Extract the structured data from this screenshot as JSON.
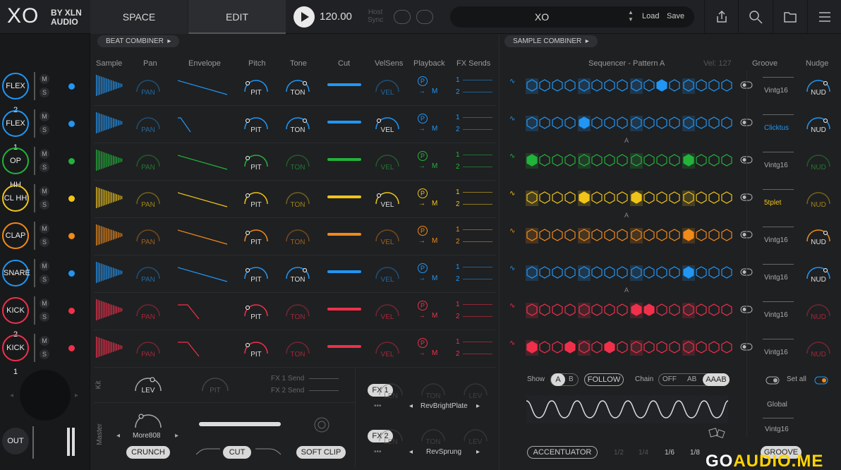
{
  "topbar": {
    "logo_xo": "XO",
    "logo_by": "BY XLN",
    "logo_audio": "AUDIO",
    "tab_space": "SPACE",
    "tab_edit": "EDIT",
    "bpm": "120.00",
    "host_sync": "Host\nSync",
    "kit_name": "XO",
    "kit_load": "Load",
    "kit_save": "Save"
  },
  "combiners": {
    "beat": "BEAT COMBINER",
    "sample": "SAMPLE COMBINER"
  },
  "headers": {
    "sample": "Sample",
    "pan": "Pan",
    "envelope": "Envelope",
    "pitch": "Pitch",
    "tone": "Tone",
    "cut": "Cut",
    "velsens": "VelSens",
    "playback": "Playback",
    "fxsends": "FX Sends",
    "sequencer": "Sequencer - Pattern A",
    "vel": "Vel: 127",
    "groove": "Groove",
    "nudge": "Nudge"
  },
  "tracks": [
    {
      "name": "FLEX 2",
      "color": "#2196f3",
      "groove": "Vintg16",
      "m": "M",
      "s": "S",
      "pan": "PAN",
      "pit": "PIT",
      "ton": "TON",
      "vel": "VEL",
      "nud": "NUD",
      "fx1": "1",
      "fx2": "2",
      "pl_p": "P",
      "pl_m": "M",
      "steps": [
        1,
        0,
        0,
        0,
        1,
        0,
        0,
        0,
        1,
        0,
        2,
        0,
        1,
        0,
        0,
        0
      ]
    },
    {
      "name": "FLEX 1",
      "color": "#2196f3",
      "groove": "Clicktus",
      "m": "M",
      "s": "S",
      "pan": "PAN",
      "pit": "PIT",
      "ton": "TON",
      "vel": "VEL",
      "nud": "NUD",
      "fx1": "1",
      "fx2": "2",
      "pl_p": "P",
      "pl_m": "M",
      "steps": [
        1,
        0,
        0,
        0,
        2,
        0,
        0,
        1,
        1,
        0,
        0,
        0,
        1,
        0,
        0,
        0
      ]
    },
    {
      "name": "OP HH",
      "color": "#22b33a",
      "groove": "Vintg16",
      "m": "M",
      "s": "S",
      "pan": "PAN",
      "pit": "PIT",
      "ton": "TON",
      "vel": "VEL",
      "nud": "NUD",
      "fx1": "1",
      "fx2": "2",
      "pl_p": "P",
      "pl_m": "M",
      "steps": [
        2,
        0,
        0,
        0,
        1,
        0,
        0,
        0,
        1,
        0,
        0,
        0,
        2,
        0,
        0,
        0
      ]
    },
    {
      "name": "CL HH",
      "color": "#f0c419",
      "groove": "5tplet",
      "m": "M",
      "s": "S",
      "pan": "PAN",
      "pit": "PIT",
      "ton": "TON",
      "vel": "VEL",
      "nud": "NUD",
      "fx1": "1",
      "fx2": "2",
      "pl_p": "P",
      "pl_m": "M",
      "steps": [
        1,
        0,
        0,
        0,
        2,
        1,
        1,
        1,
        2,
        1,
        1,
        1,
        1,
        1,
        0,
        0
      ]
    },
    {
      "name": "CLAP",
      "color": "#f08a19",
      "groove": "Vintg16",
      "m": "M",
      "s": "S",
      "pan": "PAN",
      "pit": "PIT",
      "ton": "TON",
      "vel": "VEL",
      "nud": "NUD",
      "fx1": "1",
      "fx2": "2",
      "pl_p": "P",
      "pl_m": "M",
      "steps": [
        1,
        0,
        0,
        0,
        1,
        0,
        0,
        0,
        1,
        0,
        0,
        0,
        2,
        0,
        0,
        0
      ]
    },
    {
      "name": "SNARE",
      "color": "#2196f3",
      "groove": "Vintg16",
      "m": "M",
      "s": "S",
      "pan": "PAN",
      "pit": "PIT",
      "ton": "TON",
      "vel": "VEL",
      "nud": "NUD",
      "fx1": "1",
      "fx2": "2",
      "pl_p": "P",
      "pl_m": "M",
      "steps": [
        1,
        0,
        0,
        0,
        1,
        0,
        0,
        0,
        1,
        0,
        0,
        0,
        2,
        0,
        0,
        0
      ]
    },
    {
      "name": "KICK 2",
      "color": "#f0304a",
      "groove": "Vintg16",
      "m": "M",
      "s": "S",
      "pan": "PAN",
      "pit": "PIT",
      "ton": "TON",
      "vel": "VEL",
      "nud": "NUD",
      "fx1": "1",
      "fx2": "2",
      "pl_p": "P",
      "pl_m": "M",
      "steps": [
        1,
        0,
        0,
        0,
        1,
        0,
        0,
        0,
        2,
        2,
        0,
        0,
        1,
        0,
        0,
        0
      ]
    },
    {
      "name": "KICK 1",
      "color": "#f0304a",
      "groove": "Vintg16",
      "m": "M",
      "s": "S",
      "pan": "PAN",
      "pit": "PIT",
      "ton": "TON",
      "vel": "VEL",
      "nud": "NUD",
      "fx1": "1",
      "fx2": "2",
      "pl_p": "P",
      "pl_m": "M",
      "steps": [
        2,
        0,
        0,
        2,
        0,
        0,
        2,
        0,
        1,
        0,
        0,
        0,
        1,
        0,
        0,
        0
      ]
    }
  ],
  "bottom": {
    "kit_label": "Kit",
    "master_label": "Master",
    "lev": "LEV",
    "pit": "PIT",
    "fx1send": "FX 1 Send",
    "fx2send": "FX 2 Send",
    "preset": "More808",
    "crunch": "CRUNCH",
    "cut": "CUT",
    "softclip": "SOFT CLIP",
    "fx1": "FX 1",
    "fx2": "FX 2",
    "len": "LEN",
    "ton": "TON",
    "lev2": "LEV",
    "fx1_preset": "RevBrightPlate",
    "fx2_preset": "RevSprung",
    "show": "Show",
    "show_a": "A",
    "show_b": "B",
    "follow": "FOLLOW",
    "chain": "Chain",
    "chain_off": "OFF",
    "chain_ab": "AB",
    "chain_aaab": "AAAB",
    "accentuator": "ACCENTUATOR",
    "rate_half": "1/2",
    "rate_quarter": "1/4",
    "rate_sixth": "1/6",
    "rate_eighth": "1/8",
    "set_all": "Set all",
    "global": "Global",
    "global_groove": "Vintg16",
    "groove_btn": "GROOVE",
    "out": "OUT",
    "pattern_a": "A"
  },
  "watermark": {
    "prefix": "GO",
    "brand": "AUDIO.ME"
  }
}
